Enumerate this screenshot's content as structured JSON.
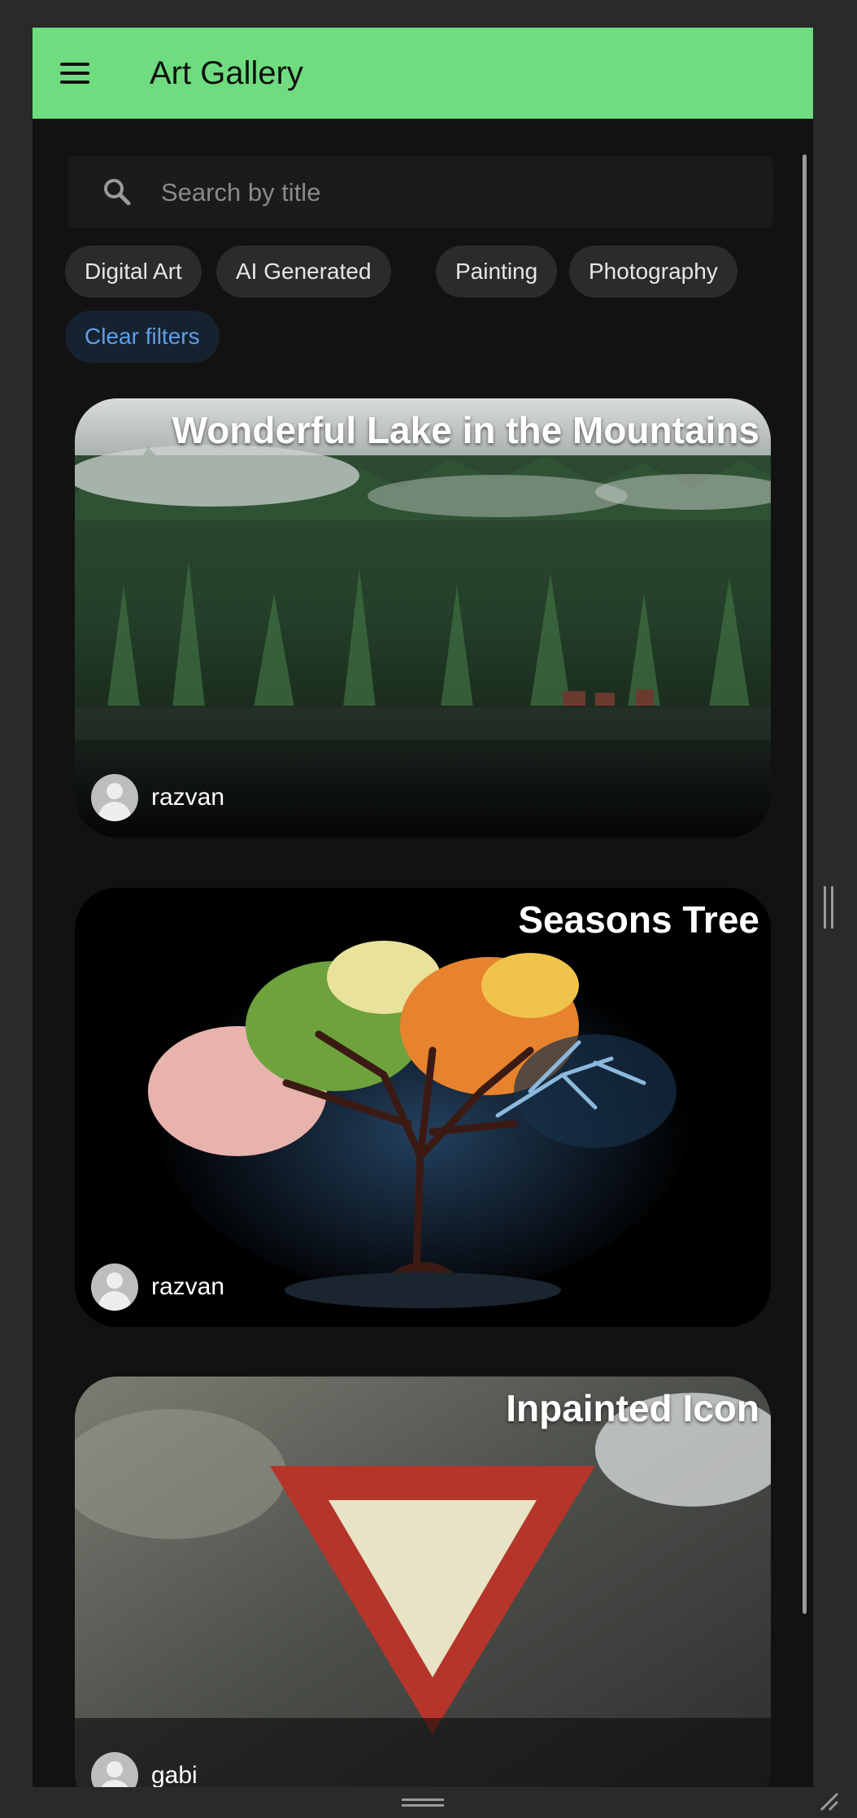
{
  "app": {
    "title": "Art Gallery"
  },
  "search": {
    "placeholder": "Search by title",
    "value": ""
  },
  "filters": {
    "chips": [
      "Digital Art",
      "AI Generated",
      "Painting",
      "Photography"
    ],
    "clear_label": "Clear filters"
  },
  "cards": [
    {
      "title": "Wonderful Lake in the Mountains",
      "author": "razvan"
    },
    {
      "title": "Seasons Tree",
      "author": "razvan"
    },
    {
      "title": "Inpainted Icon",
      "author": "gabi"
    }
  ],
  "colors": {
    "appbar": "#6fdc7f",
    "background": "#121212",
    "chip": "#2b2b2b",
    "clear_chip_text": "#5e9ee8"
  }
}
